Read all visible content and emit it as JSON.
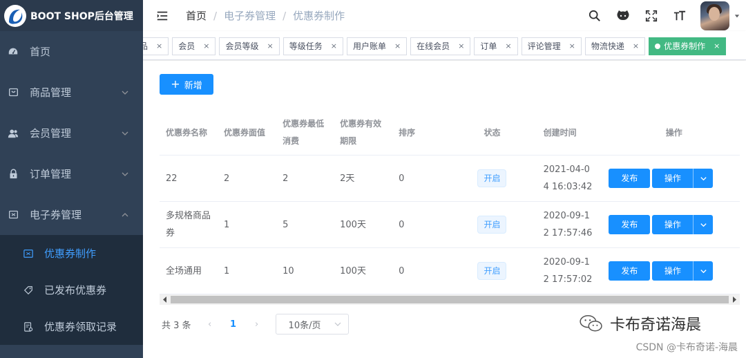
{
  "brand": {
    "title": "BOOT SHOP后台管理"
  },
  "sidebar": {
    "items": [
      {
        "label": "首页",
        "icon": "dashboard-icon",
        "has_children": false
      },
      {
        "label": "商品管理",
        "icon": "shopping-icon",
        "has_children": true,
        "expanded": false
      },
      {
        "label": "会员管理",
        "icon": "peoples-icon",
        "has_children": true,
        "expanded": false
      },
      {
        "label": "订单管理",
        "icon": "lock-icon",
        "has_children": true,
        "expanded": false
      },
      {
        "label": "电子券管理",
        "icon": "coupon-icon",
        "has_children": true,
        "expanded": true
      }
    ],
    "subitems": [
      {
        "label": "优惠券制作",
        "icon": "coupon-icon",
        "active": true
      },
      {
        "label": "已发布优惠券",
        "icon": "tag-icon",
        "active": false
      },
      {
        "label": "优惠券领取记录",
        "icon": "record-icon",
        "active": false
      }
    ]
  },
  "breadcrumb": {
    "items": [
      "首页",
      "电子券管理",
      "优惠券制作"
    ],
    "separator": "/"
  },
  "tags": [
    {
      "label": "品"
    },
    {
      "label": "会员"
    },
    {
      "label": "会员等级"
    },
    {
      "label": "等级任务"
    },
    {
      "label": "用户账单"
    },
    {
      "label": "在线会员"
    },
    {
      "label": "订单"
    },
    {
      "label": "评论管理"
    },
    {
      "label": "物流快递"
    },
    {
      "label": "优惠券制作",
      "active": true
    }
  ],
  "toolbar": {
    "add_label": "新增"
  },
  "table": {
    "headers": {
      "name": "优惠券名称",
      "value": "优惠券面值",
      "min_line1": "优惠券最低",
      "min_line2": "消费",
      "valid_line1": "优惠券有效",
      "valid_line2": "期限",
      "sort": "排序",
      "status": "状态",
      "created": "创建时间",
      "ops": "操作"
    },
    "rows": [
      {
        "name": [
          "22"
        ],
        "value": "2",
        "min": "2",
        "valid": "2天",
        "sort": "0",
        "status": "开启",
        "created": [
          "2021-04-0",
          "4 16:03:42"
        ]
      },
      {
        "name": [
          "多规格商品",
          "券"
        ],
        "value": "1",
        "min": "5",
        "valid": "100天",
        "sort": "0",
        "status": "开启",
        "created": [
          "2020-09-1",
          "2 17:57:46"
        ]
      },
      {
        "name": [
          "全场通用"
        ],
        "value": "1",
        "min": "10",
        "valid": "100天",
        "sort": "0",
        "status": "开启",
        "created": [
          "2020-09-1",
          "2 17:57:02"
        ]
      }
    ],
    "publish_label": "发布",
    "ops_label": "操作"
  },
  "pagination": {
    "total_text": "共 3 条",
    "current_page": "1",
    "page_size_label": "10条/页"
  },
  "watermark": {
    "text": "卡布奇诺海晨",
    "csdn": "CSDN @卡布奇诺-海晨"
  },
  "colors": {
    "sidebar_bg": "#304156",
    "primary": "#1890ff",
    "active_tag": "#42b983",
    "menu_active": "#409eff"
  }
}
